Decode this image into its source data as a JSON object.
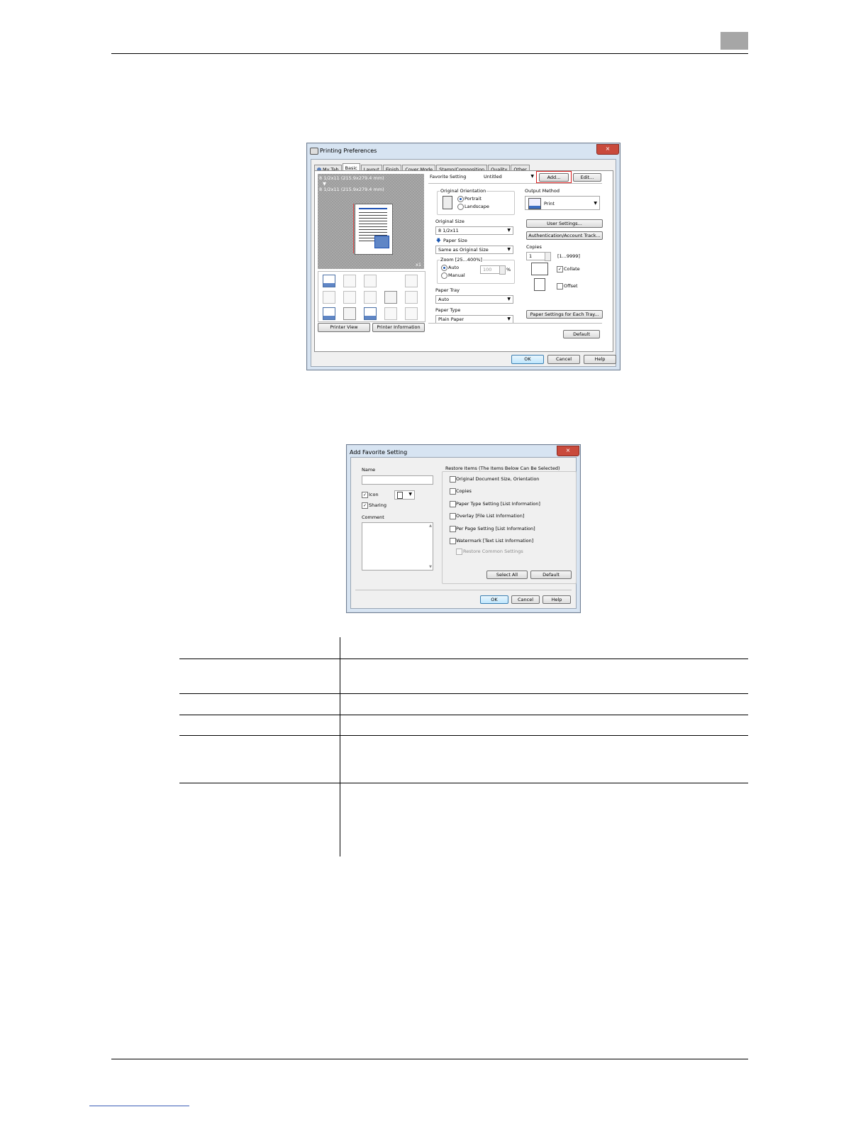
{
  "dlg1": {
    "title": "Printing Preferences",
    "close": "×",
    "tabs": [
      "My Tab",
      "Basic",
      "Layout",
      "Finish",
      "Cover Mode",
      "Stamp/Composition",
      "Quality",
      "Other"
    ],
    "preview_line1": "8 1/2x11 (215.9x279.4 mm)",
    "preview_arrow": "▼",
    "preview_line2": "8 1/2x11 (215.9x279.4 mm)",
    "preview_count": "x1",
    "printer_view": "Printer View",
    "printer_information": "Printer Information",
    "favorite_label": "Favorite Setting",
    "favorite_value": "Untitled",
    "add": "Add...",
    "edit": "Edit...",
    "orientation_label": "Original Orientation",
    "portrait": "Portrait",
    "landscape": "Landscape",
    "orig_size_label": "Original Size",
    "orig_size_value": "8 1/2x11",
    "paper_size_label": "Paper Size",
    "paper_size_value": "Same as Original Size",
    "zoom_label": "Zoom [25...400%]",
    "zoom_auto": "Auto",
    "zoom_manual": "Manual",
    "zoom_value": "100",
    "zoom_pct": "%",
    "paper_tray_label": "Paper Tray",
    "paper_tray_value": "Auto",
    "paper_type_label": "Paper Type",
    "paper_type_value": "Plain Paper",
    "output_label": "Output Method",
    "output_value": "Print",
    "user_settings": "User Settings...",
    "auth": "Authentication/Account Track...",
    "copies_label": "Copies",
    "copies_value": "1",
    "copies_range": "[1...9999]",
    "collate": "Collate",
    "offset": "Offset",
    "paper_each_tray": "Paper Settings for Each Tray...",
    "default": "Default",
    "ok": "OK",
    "cancel": "Cancel",
    "help": "Help"
  },
  "dlg2": {
    "title": "Add Favorite Setting",
    "close": "×",
    "name_label": "Name",
    "icon": "Icon",
    "sharing": "Sharing",
    "comment_label": "Comment",
    "restore_label": "Restore Items (The Items Below Can Be Selected)",
    "items": [
      "Original Document Size, Orientation",
      "Copies",
      "Paper Type Setting [List Information]",
      "Overlay [File List Information]",
      "Per Page Setting [List Information]",
      "Watermark [Text List Information]"
    ],
    "restore_common": "Restore Common Settings",
    "select_all": "Select All",
    "default": "Default",
    "ok": "OK",
    "cancel": "Cancel",
    "help": "Help"
  }
}
